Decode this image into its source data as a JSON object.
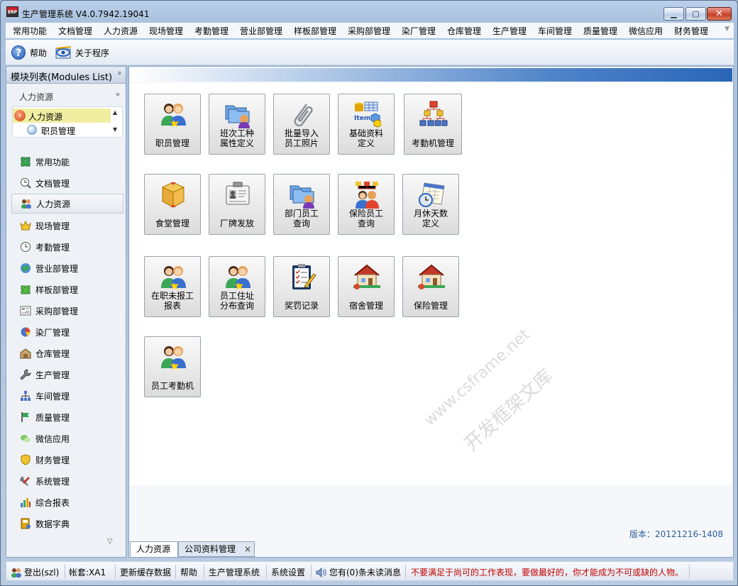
{
  "window": {
    "title": "生产管理系统 V4.0.7942.19041",
    "app_icon_text": "ERP"
  },
  "menubar": {
    "items": [
      "常用功能",
      "文档管理",
      "人力资源",
      "现场管理",
      "考勤管理",
      "营业部管理",
      "样板部管理",
      "采购部管理",
      "染厂管理",
      "仓库管理",
      "生产管理",
      "车间管理",
      "质量管理",
      "微信应用",
      "财务管理"
    ]
  },
  "toolbar": {
    "help_label": "帮助",
    "about_label": "关于程序"
  },
  "left_pane": {
    "title": "模块列表(Modules List)",
    "section_label": "人力资源",
    "tree": {
      "selected": "人力资源",
      "child": "职员管理"
    },
    "nav_items": [
      {
        "label": "常用功能",
        "icon": "puzzle-icon"
      },
      {
        "label": "文档管理",
        "icon": "clock-search-icon"
      },
      {
        "label": "人力资源",
        "icon": "people-icon"
      },
      {
        "label": "现场管理",
        "icon": "crown-icon"
      },
      {
        "label": "考勤管理",
        "icon": "clock-icon"
      },
      {
        "label": "营业部管理",
        "icon": "globe-icon"
      },
      {
        "label": "样板部管理",
        "icon": "green-puzzle-icon"
      },
      {
        "label": "采购部管理",
        "icon": "list-icon"
      },
      {
        "label": "染厂管理",
        "icon": "pie-chart-icon"
      },
      {
        "label": "仓库管理",
        "icon": "warehouse-icon"
      },
      {
        "label": "生产管理",
        "icon": "wrench-icon"
      },
      {
        "label": "车间管理",
        "icon": "org-chart-icon"
      },
      {
        "label": "质量管理",
        "icon": "flag-icon"
      },
      {
        "label": "微信应用",
        "icon": "wechat-icon"
      },
      {
        "label": "财务管理",
        "icon": "shield-icon"
      },
      {
        "label": "系统管理",
        "icon": "tools-icon"
      },
      {
        "label": "综合报表",
        "icon": "bar-chart-icon"
      },
      {
        "label": "数据字典",
        "icon": "dictionary-icon"
      }
    ],
    "active_nav": "人力资源"
  },
  "main": {
    "tiles": [
      {
        "label": "职员管理",
        "icon": "people-icon"
      },
      {
        "label": "班次工种\n属性定义",
        "icon": "folder-user-icon"
      },
      {
        "label": "批量导入\n员工照片",
        "icon": "paperclip-icon"
      },
      {
        "label": "基础资料\n定义",
        "icon": "item-cubes-icon"
      },
      {
        "label": "考勤机管理",
        "icon": "org-chart-icon"
      },
      {
        "label": "食堂管理",
        "icon": "box-icon"
      },
      {
        "label": "厂牌发放",
        "icon": "badge-icon"
      },
      {
        "label": "部门员工\n查询",
        "icon": "folder-user-icon"
      },
      {
        "label": "保险员工\n查询",
        "icon": "team-org-icon"
      },
      {
        "label": "月休天数\n定义",
        "icon": "calendar-clock-icon"
      },
      {
        "label": "在职未报工\n报表",
        "icon": "people-icon"
      },
      {
        "label": "员工住址\n分布查询",
        "icon": "people-icon"
      },
      {
        "label": "奖罚记录",
        "icon": "checklist-icon"
      },
      {
        "label": "宿舍管理",
        "icon": "house-icon"
      },
      {
        "label": "保险管理",
        "icon": "house-icon"
      },
      {
        "label": "员工考勤机",
        "icon": "people-icon"
      }
    ],
    "version": "版本：20121216-1408",
    "watermark_1": "www.csframe.net",
    "watermark_2": "开发框架文库"
  },
  "tabs": [
    {
      "label": "人力资源",
      "active": true
    },
    {
      "label": "公司资料管理",
      "active": false,
      "close": "×"
    }
  ],
  "statusbar": {
    "logout": "登出(szl)",
    "account": "帐套:XA1",
    "refresh": "更新缓存数据",
    "help": "帮助",
    "system": "生产管理系统",
    "settings": "系统设置",
    "messages": "您有(0)条未读消息",
    "motto": "不要满足于尚可的工作表现，要做最好的，你才能成为不可或缺的人物。"
  },
  "colors": {
    "accent_blue": "#2a65b8",
    "selection_yellow": "#f1eea2",
    "motto_red": "#c00000",
    "version_blue": "#2e5f9e"
  }
}
